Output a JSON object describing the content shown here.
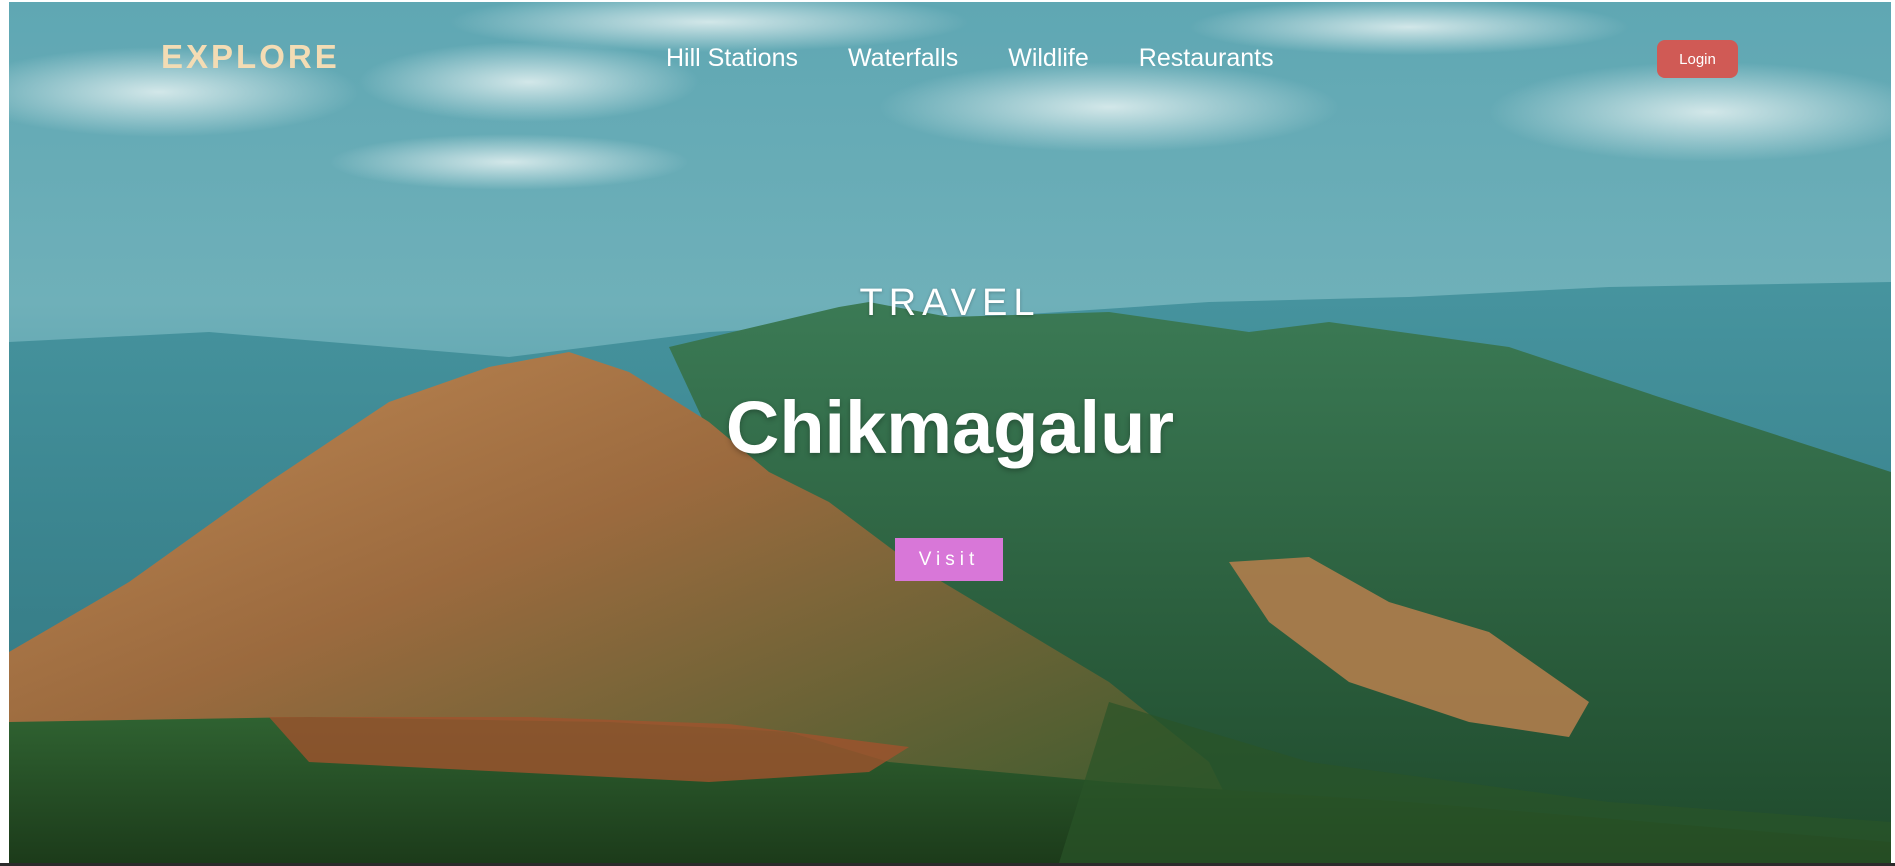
{
  "nav": {
    "logo": "EXPLORE",
    "links": [
      "Hill Stations",
      "Waterfalls",
      "Wildlife",
      "Restaurants"
    ],
    "login_label": "Login"
  },
  "hero": {
    "subtitle": "TRAVEL",
    "title": "Chikmagalur",
    "cta_label": "Visit",
    "background": "mountain-landscape-photo"
  },
  "colors": {
    "logo": "#f3dcb4",
    "login_button": "#d05a55",
    "visit_button": "#d877d8",
    "sky": "#4a9aa6",
    "hill_green": "#2f5a2c",
    "hill_brown": "#b87a4c"
  }
}
